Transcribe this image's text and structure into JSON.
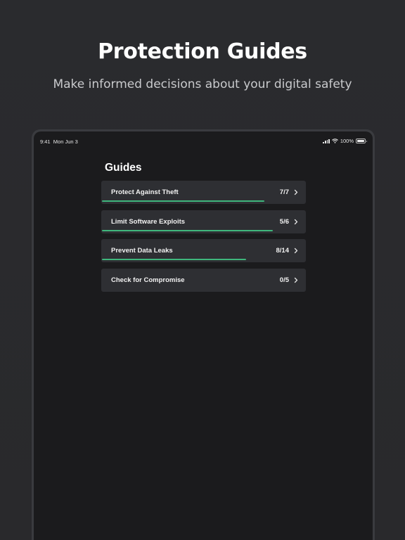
{
  "hero": {
    "title": "Protection Guides",
    "subtitle": "Make informed decisions about your digital safety"
  },
  "status_bar": {
    "time": "9:41",
    "date": "Mon Jun 3",
    "battery": "100%",
    "icons": [
      "signal-icon",
      "wifi-icon",
      "battery-icon"
    ]
  },
  "screen": {
    "title": "Guides",
    "guides": [
      {
        "label": "Protect Against Theft",
        "count": "7/7",
        "progress": 0.8
      },
      {
        "label": "Limit Software Exploits",
        "count": "5/6",
        "progress": 0.84
      },
      {
        "label": "Prevent Data Leaks",
        "count": "8/14",
        "progress": 0.71
      },
      {
        "label": "Check for Compromise",
        "count": "0/5",
        "progress": 0
      }
    ]
  },
  "colors": {
    "accent": "#3fb67c",
    "background": "#2a2b2e",
    "screen": "#1b1b1d",
    "card": "#2e2f33"
  }
}
